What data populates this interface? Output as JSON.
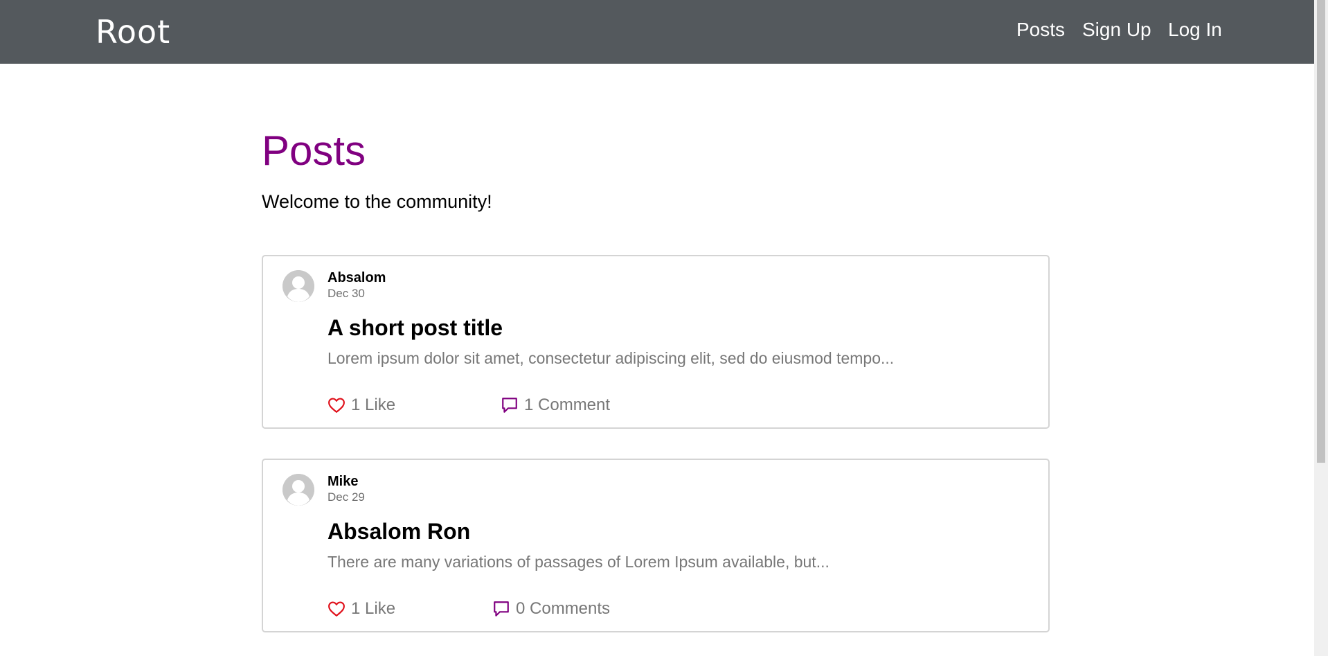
{
  "navbar": {
    "brand": "Root",
    "links": [
      "Posts",
      "Sign Up",
      "Log In"
    ]
  },
  "main": {
    "title": "Posts",
    "subtitle": "Welcome to the community!"
  },
  "posts": [
    {
      "author": "Absalom",
      "date": "Dec 30",
      "title": "A short post title",
      "excerpt": "Lorem ipsum dolor sit amet, consectetur adipiscing elit, sed do eiusmod tempo...",
      "likes": "1 Like",
      "comments": "1 Comment"
    },
    {
      "author": "Mike",
      "date": "Dec 29",
      "title": "Absalom Ron",
      "excerpt": "There are many variations of passages of Lorem Ipsum available, but...",
      "likes": "1 Like",
      "comments": "0 Comments"
    }
  ],
  "icons": {
    "like": "heart-icon",
    "comment": "speech-bubble-icon",
    "avatar": "user-silhouette-icon"
  },
  "colors": {
    "navbar": "#54595d",
    "title": "#800080",
    "heart": "#e0101a",
    "comment": "#800080",
    "muted": "#777777"
  }
}
